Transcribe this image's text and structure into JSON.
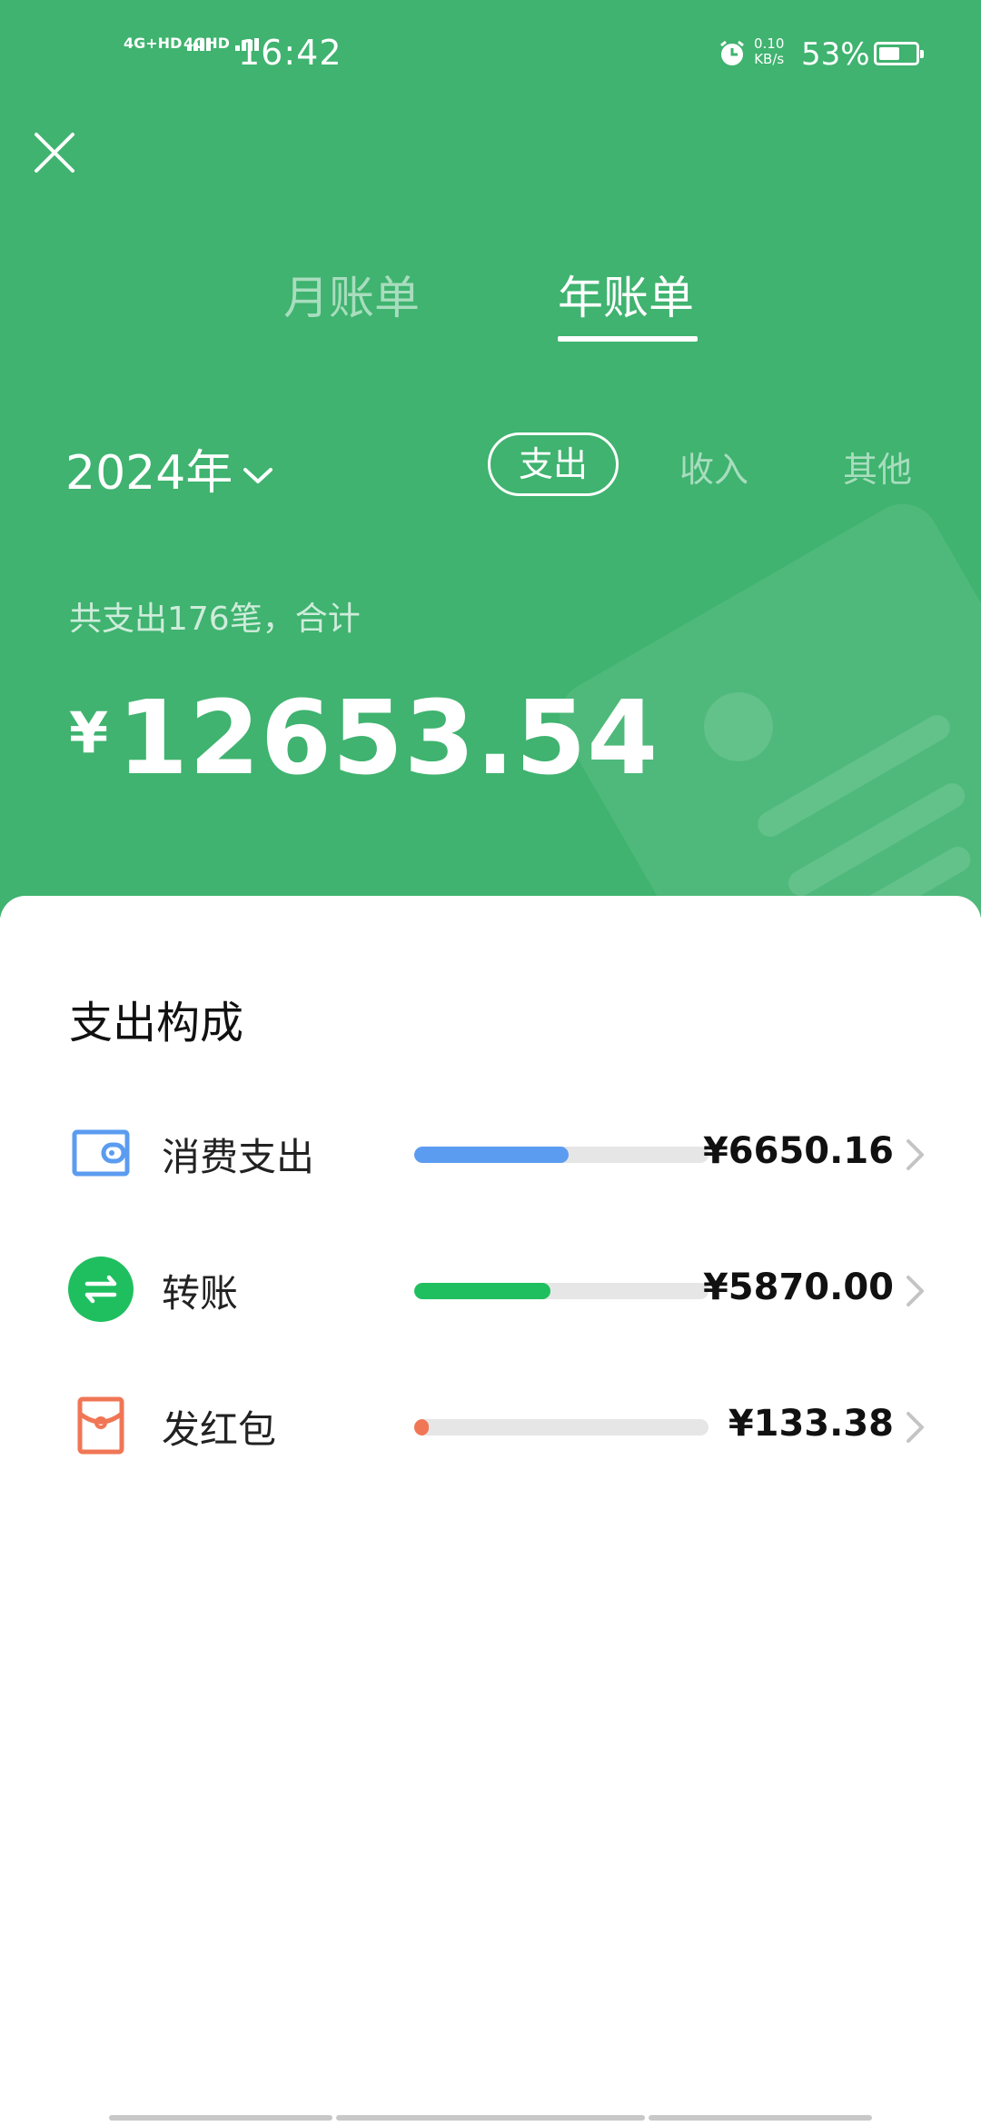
{
  "status_bar": {
    "signal1": "4G+HD",
    "signal2": "4GHD",
    "time": "16:42",
    "net_speed_value": "0.10",
    "net_speed_unit": "KB/s",
    "battery": "53%",
    "battery_level": 0.53
  },
  "tabs": [
    {
      "label": "月账单"
    },
    {
      "label": "年账单"
    }
  ],
  "year_selector": "2024年",
  "filters": [
    {
      "label": "支出"
    },
    {
      "label": "收入"
    },
    {
      "label": "其他"
    }
  ],
  "summary": {
    "text": "共支出176笔，合计",
    "currency": "¥",
    "amount": "12653.54"
  },
  "composition": {
    "title": "支出构成",
    "items": [
      {
        "label": "消费支出",
        "value": "¥6650.16",
        "fraction": 0.525,
        "color": "#5b9cf0",
        "icon": "wallet-icon"
      },
      {
        "label": "转账",
        "value": "¥5870.00",
        "fraction": 0.464,
        "color": "#1fbf5f",
        "icon": "transfer-icon"
      },
      {
        "label": "发红包",
        "value": "¥133.38",
        "fraction": 0.011,
        "color": "#f07655",
        "icon": "red-envelope-icon"
      }
    ]
  },
  "colors": {
    "header_green": "#3fb36f",
    "wallet_blue": "#5b9cf0",
    "transfer_green": "#1fbf5f",
    "envelope_orange": "#f07655"
  }
}
